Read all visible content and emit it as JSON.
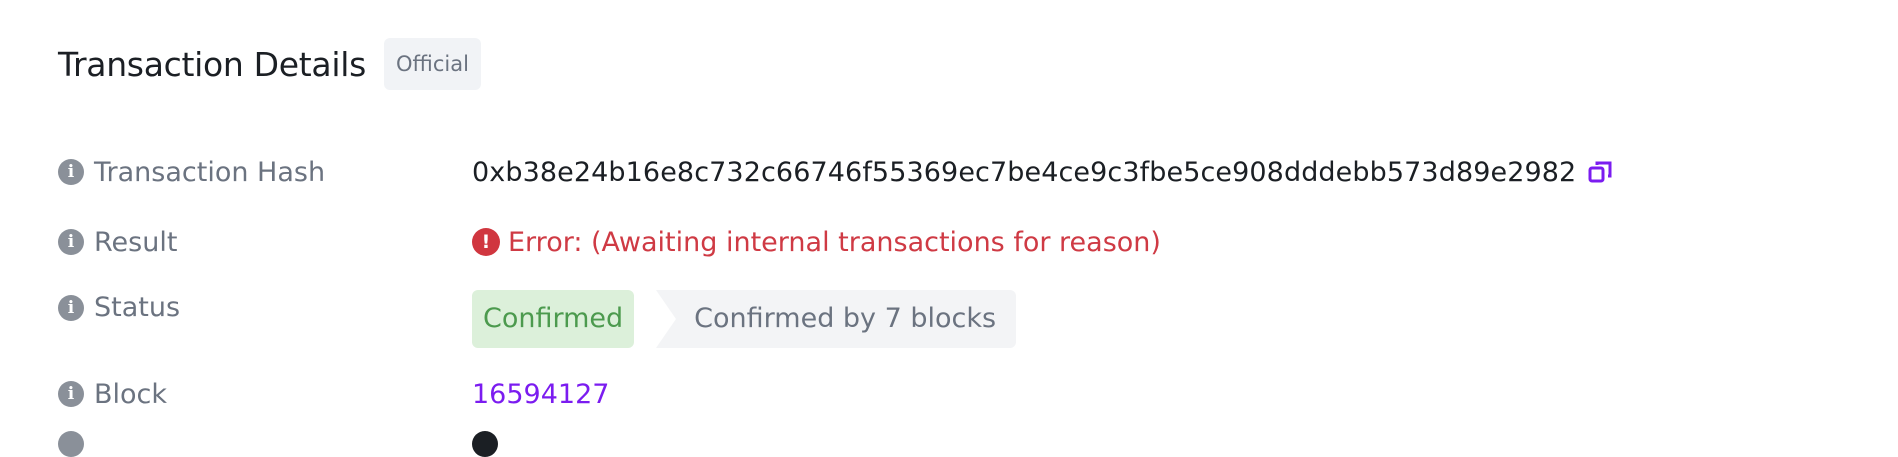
{
  "header": {
    "title": "Transaction Details",
    "badge": "Official"
  },
  "rows": {
    "hash": {
      "label": "Transaction Hash",
      "value": "0xb38e24b16e8c732c66746f55369ec7be4ce9c3fbe5ce908dddebb573d89e2982",
      "icon": "copy-icon"
    },
    "result": {
      "label": "Result",
      "value": "Error: (Awaiting internal transactions for reason)",
      "icon": "error-icon",
      "color": "#cf3a44"
    },
    "status": {
      "label": "Status",
      "badge": "Confirmed",
      "confirmations": "Confirmed by 7 blocks",
      "color": "#4c9a4e"
    },
    "block": {
      "label": "Block",
      "value": "16594127",
      "color": "#7b1cf0"
    }
  },
  "icons": {
    "info": "info-icon"
  }
}
